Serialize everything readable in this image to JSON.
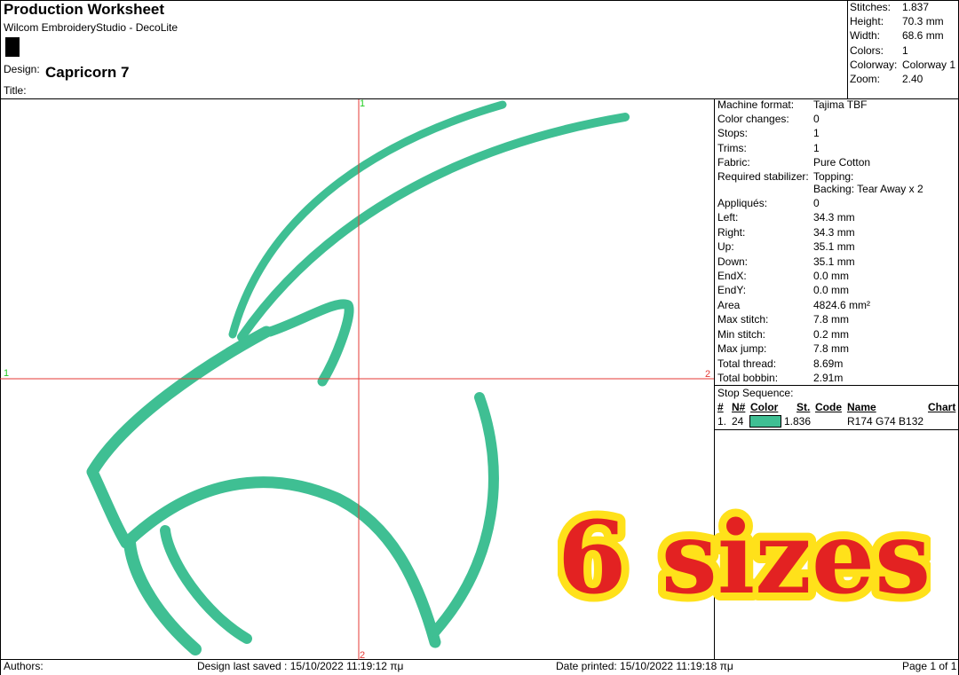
{
  "header": {
    "title": "Production Worksheet",
    "software": "Wilcom EmbroideryStudio - DecoLite",
    "design_label": "Design:",
    "design_name": "Capricorn 7",
    "title_label": "Title:"
  },
  "summary": {
    "rows": [
      {
        "label": "Stitches:",
        "value": "1.837"
      },
      {
        "label": "Height:",
        "value": "70.3 mm"
      },
      {
        "label": "Width:",
        "value": "68.6 mm"
      },
      {
        "label": "Colors:",
        "value": "1"
      },
      {
        "label": "Colorway:",
        "value": "Colorway 1"
      },
      {
        "label": "Zoom:",
        "value": "2.40"
      }
    ]
  },
  "details": {
    "rows": [
      {
        "label": "Machine format:",
        "value": "Tajima TBF"
      },
      {
        "label": "Color changes:",
        "value": "0"
      },
      {
        "label": "Stops:",
        "value": "1"
      },
      {
        "label": "Trims:",
        "value": "1"
      },
      {
        "label": "Fabric:",
        "value": "Pure Cotton"
      },
      {
        "label": "Required stabilizer:",
        "value": "Topping:",
        "value2": "Backing: Tear Away x 2"
      },
      {
        "label": "Appliqués:",
        "value": "0"
      },
      {
        "label": "Left:",
        "value": "34.3 mm"
      },
      {
        "label": "Right:",
        "value": "34.3 mm"
      },
      {
        "label": "Up:",
        "value": "35.1 mm"
      },
      {
        "label": "Down:",
        "value": "35.1 mm"
      },
      {
        "label": "EndX:",
        "value": "0.0 mm"
      },
      {
        "label": "EndY:",
        "value": "0.0 mm"
      },
      {
        "label": "Area",
        "value": "4824.6 mm²"
      },
      {
        "label": "Max stitch:",
        "value": "7.8 mm"
      },
      {
        "label": "Min stitch:",
        "value": "0.2 mm"
      },
      {
        "label": "Max jump:",
        "value": "7.8 mm"
      },
      {
        "label": "Total thread:",
        "value": "8.69m"
      },
      {
        "label": "Total bobbin:",
        "value": "2.91m"
      }
    ]
  },
  "stop_sequence": {
    "title": "Stop Sequence:",
    "columns": [
      "#",
      "N#",
      "Color",
      "St.",
      "Code",
      "Name",
      "Chart"
    ],
    "rows": [
      {
        "num": "1.",
        "n": "24",
        "color": "#3fbf93",
        "stitches": "1.836",
        "code": "",
        "name": "R174 G74 B132",
        "chart": ""
      }
    ]
  },
  "canvas": {
    "axis_top": "1",
    "axis_left": "1",
    "axis_right": "2",
    "axis_bottom": "2",
    "thread_color": "#3fbf93",
    "crosshair_color": "#e53935",
    "axis_label_green": "#22cc22"
  },
  "overlay": {
    "text": "6 sizes",
    "fill": "#e32222",
    "outline": "#ffe11a"
  },
  "footer": {
    "authors": "Authors:",
    "saved": "Design last saved : 15/10/2022 11:19:12 πμ",
    "printed": "Date printed: 15/10/2022 11:19:18 πμ",
    "page": "Page 1 of 1"
  }
}
